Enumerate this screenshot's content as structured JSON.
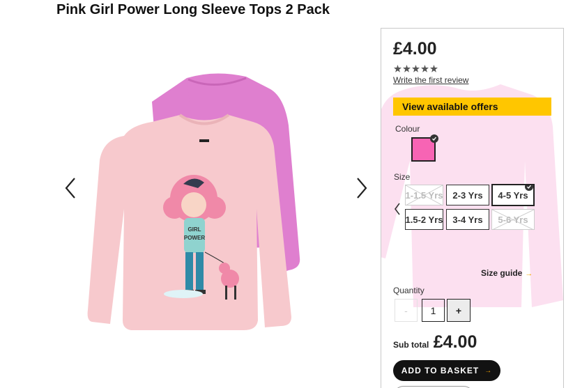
{
  "product": {
    "title": "Pink Girl Power Long Sleeve Tops 2 Pack"
  },
  "gallery": {
    "prev_icon": "chevron-left-icon",
    "next_icon": "chevron-right-icon",
    "shirt_print_text": [
      "GIRL",
      "POWER"
    ]
  },
  "panel": {
    "price": "£4.00",
    "rating": {
      "value": 0,
      "max": 5,
      "star_color": "#555555"
    },
    "review_link": "Write the first review",
    "offers_button": "View available offers",
    "offers_color": "#ffc600",
    "colour_label": "Colour",
    "selected_colour_hex": "#f764b4",
    "size_label": "Size",
    "sizes": [
      {
        "label": "1-1.5 Yrs",
        "available": false,
        "selected": false
      },
      {
        "label": "2-3 Yrs",
        "available": true,
        "selected": false
      },
      {
        "label": "4-5 Yrs",
        "available": true,
        "selected": true
      },
      {
        "label": "1.5-2 Yrs",
        "available": true,
        "selected": false
      },
      {
        "label": "3-4 Yrs",
        "available": true,
        "selected": false
      },
      {
        "label": "5-6 Yrs",
        "available": false,
        "selected": false
      }
    ],
    "size_guide": "Size guide",
    "quantity_label": "Quantity",
    "quantity_minus": "-",
    "quantity_value": "1",
    "quantity_plus": "+",
    "subtotal_label": "Sub total",
    "subtotal_value": "£4.00",
    "add_to_basket": "ADD TO BASKET",
    "accent_color": "#f5a500"
  }
}
